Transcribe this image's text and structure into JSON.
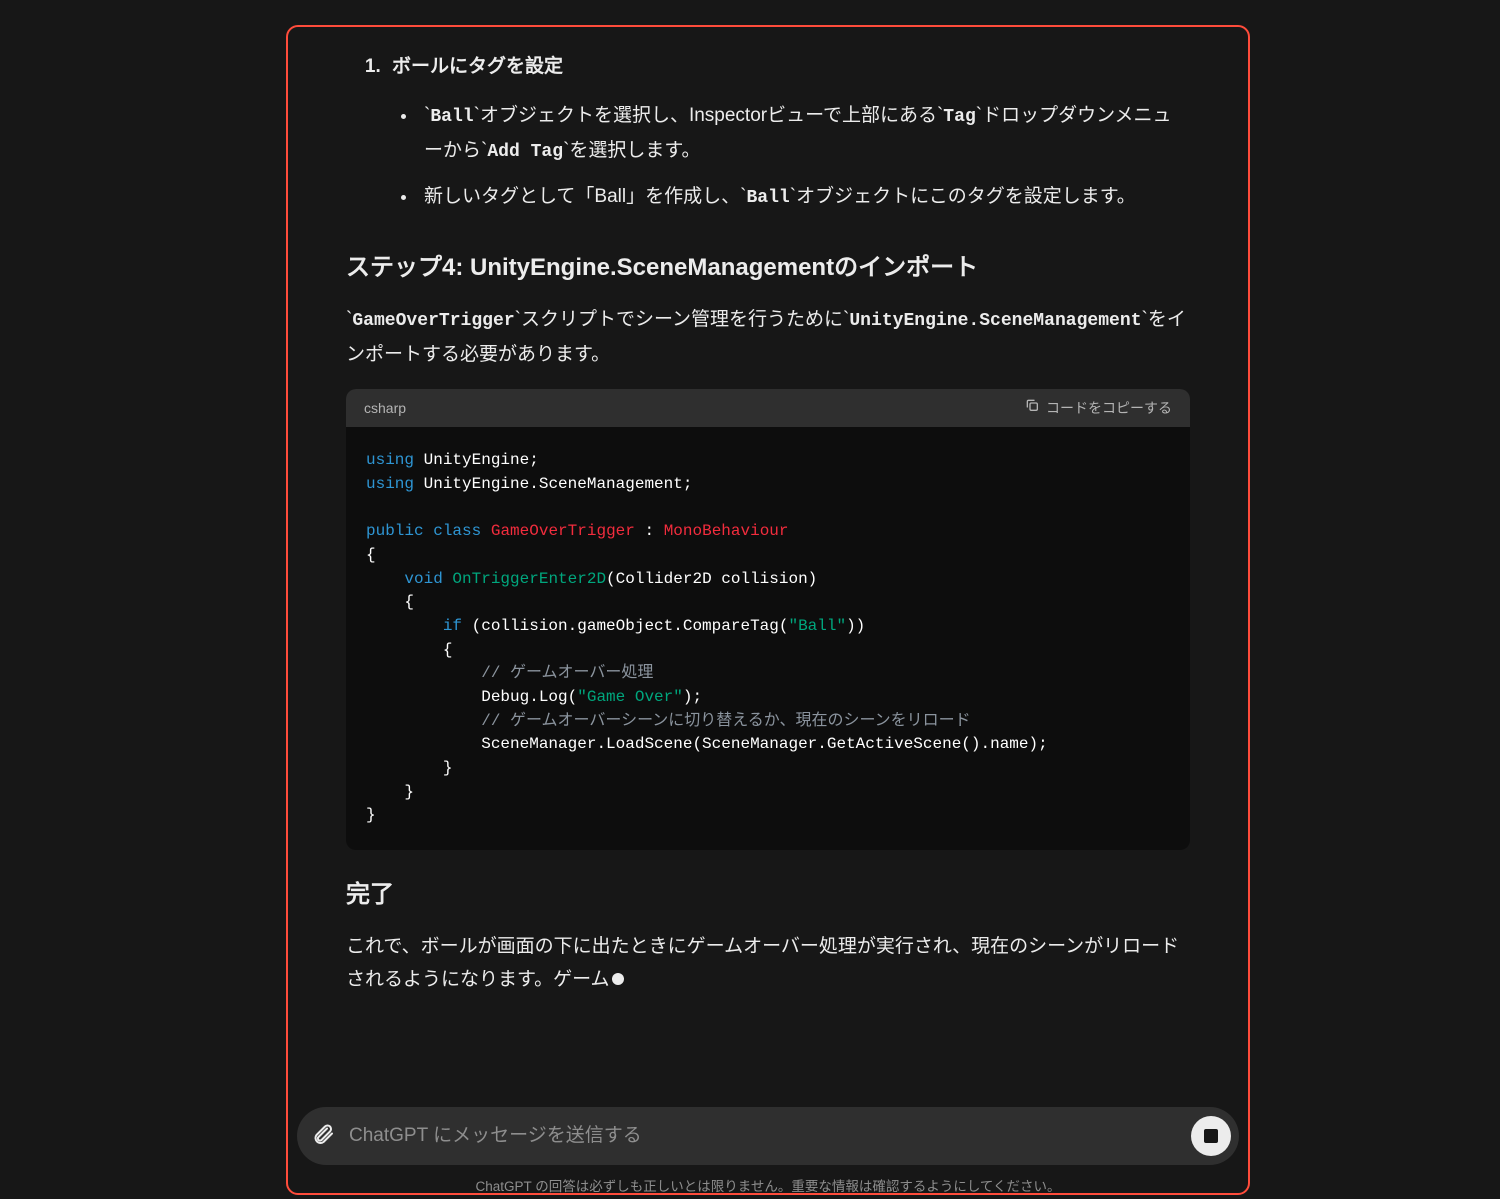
{
  "list": {
    "item1_title": "ボールにタグを設定",
    "sub1_prefix": "`",
    "sub1_code1": "Ball",
    "sub1_mid1": "`オブジェクトを選択し、Inspectorビューで上部にある`",
    "sub1_code2": "Tag",
    "sub1_mid2": "`ドロップダウンメニューから`",
    "sub1_code3": "Add Tag",
    "sub1_suffix": "`を選択します。",
    "sub2_prefix": "新しいタグとして「Ball」を作成し、`",
    "sub2_code1": "Ball",
    "sub2_suffix": "`オブジェクトにこのタグを設定します。"
  },
  "heading_step4": "ステップ4: UnityEngine.SceneManagementのインポート",
  "para_step4_prefix": "`",
  "para_step4_code1": "GameOverTrigger",
  "para_step4_mid1": "`スクリプトでシーン管理を行うために`",
  "para_step4_code2": "UnityEngine.SceneManagement",
  "para_step4_suffix": "`をインポートする必要があります。",
  "code": {
    "lang": "csharp",
    "copy_label": "コードをコピーする",
    "l1_kw": "using",
    "l1_rest": " UnityEngine;",
    "l2_kw": "using",
    "l2_rest": " UnityEngine.SceneManagement;",
    "l4_kw1": "public",
    "l4_kw2": "class",
    "l4_cls": "GameOverTrigger",
    "l4_colon": " : ",
    "l4_base": "MonoBehaviour",
    "l5": "{",
    "l6_kw": "void",
    "l6_fn": "OnTriggerEnter2D",
    "l6_args": "(Collider2D collision)",
    "l7": "    {",
    "l8_kw": "if",
    "l8_cond_a": " (collision.gameObject.CompareTag(",
    "l8_str": "\"Ball\"",
    "l8_cond_b": "))",
    "l9": "        {",
    "l10_com": "// ゲームオーバー処理",
    "l11_a": "Debug.Log(",
    "l11_str": "\"Game Over\"",
    "l11_b": ");",
    "l12_com": "// ゲームオーバーシーンに切り替えるか、現在のシーンをリロード",
    "l13": "SceneManager.LoadScene(SceneManager.GetActiveScene().name);",
    "l14": "        }",
    "l15": "    }",
    "l16": "}"
  },
  "heading_done": "完了",
  "para_done": "これで、ボールが画面の下に出たときにゲームオーバー処理が実行され、現在のシーンがリロードされるようになります。ゲーム",
  "input": {
    "placeholder": "ChatGPT にメッセージを送信する"
  },
  "disclaimer": "ChatGPT の回答は必ずしも正しいとは限りません。重要な情報は確認するようにしてください。"
}
